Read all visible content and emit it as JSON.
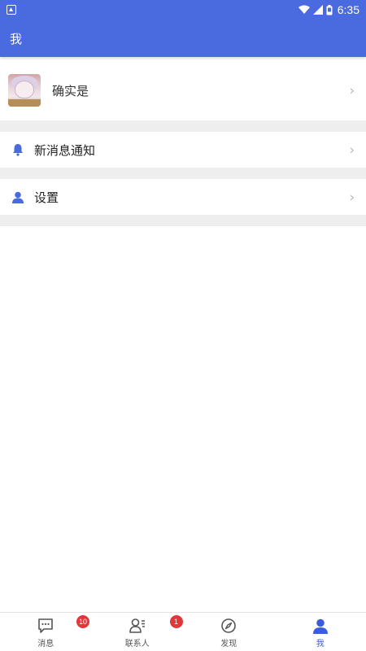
{
  "status_bar": {
    "time": "6:35"
  },
  "app_bar": {
    "title": "我"
  },
  "profile": {
    "name": "确实是",
    "chevron": "›"
  },
  "menu": [
    {
      "label": "新消息通知",
      "icon": "bell-icon",
      "chevron": "›"
    },
    {
      "label": "设置",
      "icon": "person-icon",
      "chevron": "›"
    }
  ],
  "bottom_nav": [
    {
      "label": "消息",
      "icon": "chat-icon",
      "badge": "10",
      "active": false
    },
    {
      "label": "联系人",
      "icon": "contacts-icon",
      "badge": "1",
      "active": false
    },
    {
      "label": "发现",
      "icon": "compass-icon",
      "badge": "",
      "active": false
    },
    {
      "label": "我",
      "icon": "person-icon",
      "badge": "",
      "active": true
    }
  ],
  "colors": {
    "primary": "#4a6ae0",
    "badge": "#e0373a",
    "active_tab": "#3b5ed8"
  }
}
